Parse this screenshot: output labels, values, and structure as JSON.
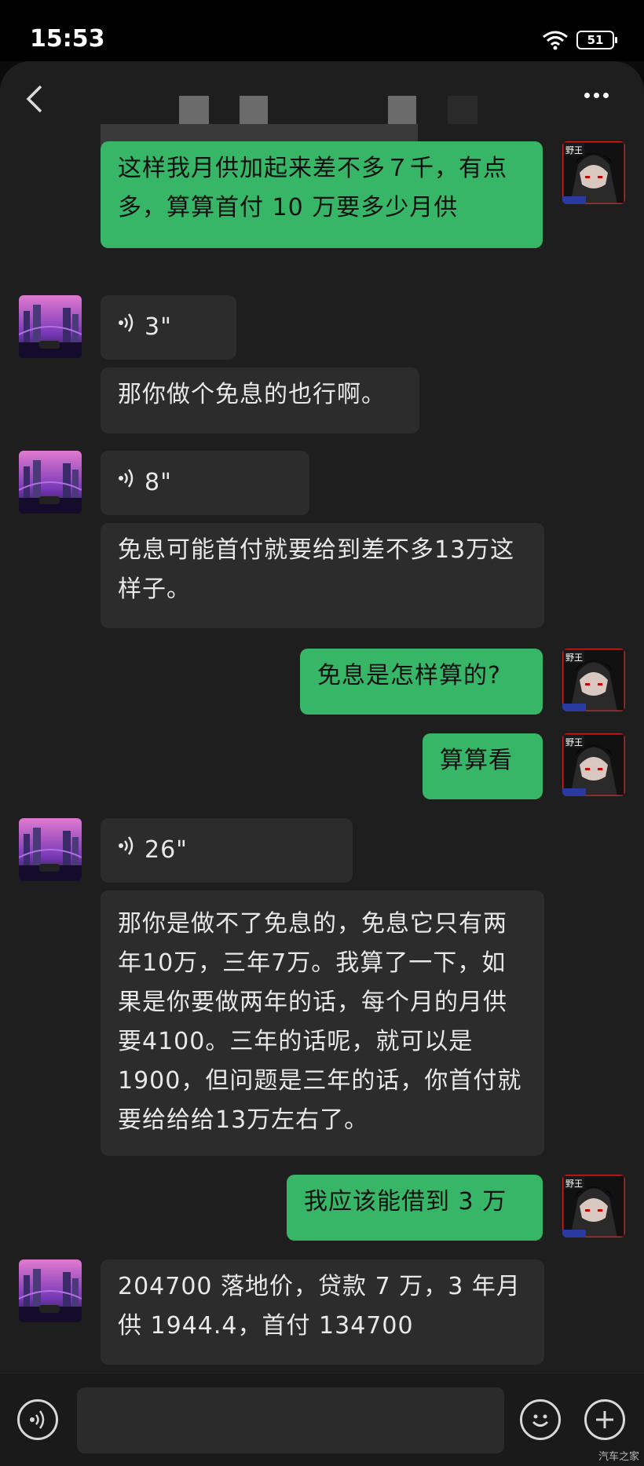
{
  "status_bar": {
    "time": "15:53",
    "battery": "51"
  },
  "chat": {
    "messages": [
      {
        "side": "right",
        "type": "text",
        "text": "这样我月供加起来差不多７千，有点多，算算首付 10 万要多少月供"
      },
      {
        "side": "left",
        "type": "voice",
        "duration": "3\""
      },
      {
        "side": "left",
        "type": "text",
        "text": "那你做个免息的也行啊。"
      },
      {
        "side": "left",
        "type": "voice",
        "duration": "8\""
      },
      {
        "side": "left",
        "type": "text",
        "text": "免息可能首付就要给到差不多13万这样子。"
      },
      {
        "side": "right",
        "type": "text",
        "text": "免息是怎样算的?"
      },
      {
        "side": "right",
        "type": "text",
        "text": "算算看"
      },
      {
        "side": "left",
        "type": "voice",
        "duration": "26\""
      },
      {
        "side": "left",
        "type": "text",
        "text": "那你是做不了免息的，免息它只有两年10万，三年7万。我算了一下，如果是你要做两年的话，每个月的月供要4100。三年的话呢，就可以是1900，但问题是三年的话，你首付就要给给给13万左右了。"
      },
      {
        "side": "right",
        "type": "text",
        "text": "我应该能借到 3 万"
      },
      {
        "side": "left",
        "type": "text",
        "text": "204700 落地价，贷款 7 万，3 年月供 1944.4，首付 134700"
      }
    ],
    "my_avatar_badge": "野王"
  },
  "watermark": "汽车之家",
  "colors": {
    "my_bubble": "#37b668",
    "their_bubble": "#2c2c2c",
    "background": "#1e1e1e"
  }
}
